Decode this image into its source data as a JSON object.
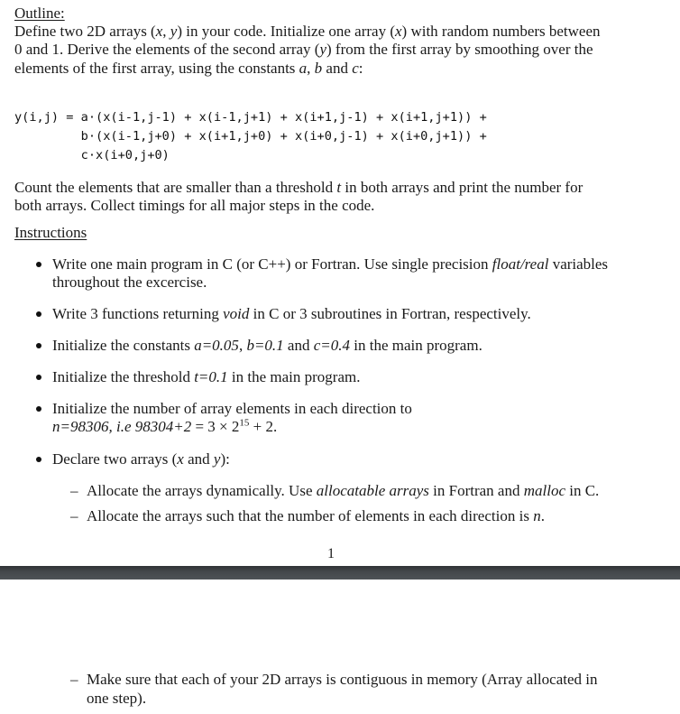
{
  "outline": {
    "heading": "Outline:",
    "para1_lines": [
      [
        "Define two 2D arrays (",
        "x",
        ", ",
        "y",
        ") in your code. Initialize one array (",
        "x",
        ") with random numbers between"
      ],
      [
        "0 and 1. Derive the elements of the second array (",
        "y",
        ") from the first array by smoothing over the"
      ],
      [
        "elements of the first array, using the constants ",
        "a",
        ", ",
        "b",
        " and ",
        "c",
        ":"
      ]
    ],
    "formula_lines": [
      "y(i,j) = a·(x(i-1,j-1) + x(i-1,j+1) + x(i+1,j-1) + x(i+1,j+1)) +",
      "         b·(x(i-1,j+0) + x(i+1,j+0) + x(i+0,j-1) + x(i+0,j+1)) +",
      "         c·x(i+0,j+0)"
    ],
    "para2_lines": [
      [
        "Count the elements that are smaller than a threshold ",
        "t",
        " in both arrays and print the number for"
      ],
      [
        "both arrays. Collect timings for all major steps in the code."
      ]
    ]
  },
  "instructions": {
    "heading": "Instructions",
    "items": [
      {
        "lines": [
          [
            "Write one main program in C (or C++) or Fortran. Use single precision ",
            "float/real",
            " variables"
          ],
          [
            "throughout the excercise."
          ]
        ]
      },
      {
        "lines": [
          [
            "Write 3 functions returning ",
            "void",
            " in C or 3 subroutines in Fortran, respectively."
          ]
        ]
      },
      {
        "lines": [
          [
            "Initialize the constants ",
            "a=0.05",
            ", ",
            "b=0.1",
            " and ",
            "c=0.4",
            " in the main program."
          ]
        ]
      },
      {
        "lines": [
          [
            "Initialize the threshold ",
            "t=0.1",
            " in the main program."
          ]
        ]
      },
      {
        "lines": [
          [
            "Initialize the number of array elements in each direction to"
          ],
          [
            "",
            "n=98306, i.e 98304+2",
            " = 3 × 2",
            "15",
            " + 2."
          ]
        ]
      },
      {
        "lines": [
          [
            "Declare two arrays (",
            "x",
            " and ",
            "y",
            "):"
          ]
        ]
      }
    ],
    "subitems": [
      [
        "Allocate the arrays dynamically. Use ",
        "allocatable arrays",
        " in Fortran and ",
        "malloc",
        " in C."
      ],
      [
        "Allocate the arrays such that the number of elements in each direction is ",
        "n",
        "."
      ]
    ],
    "page2_subitem_lines": [
      [
        "Make sure that each of your 2D arrays is contiguous in memory (Array allocated in"
      ],
      [
        "one step)."
      ]
    ]
  },
  "page_number": "1",
  "dash_glyph": "–"
}
